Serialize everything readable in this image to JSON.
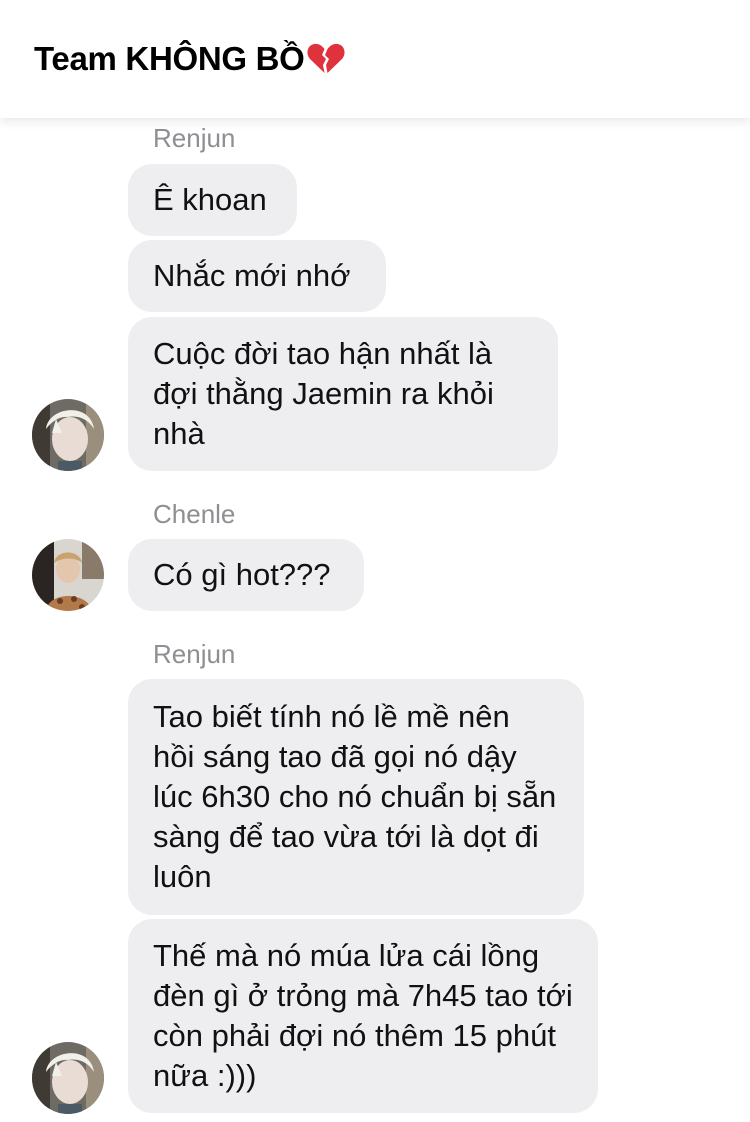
{
  "header": {
    "title": "Team KHÔNG BỒ",
    "title_icon": "broken-heart-icon"
  },
  "messages": [
    {
      "sender": "Renjun"
    },
    {
      "text": "Ê khoan"
    },
    {
      "text": "Nhắc mới nhớ"
    },
    {
      "text": "Cuộc đời tao hận nhất là đợi thằng Jaemin ra khỏi nhà"
    },
    {
      "sender": "Chenle"
    },
    {
      "text": "Có gì hot???"
    },
    {
      "sender": "Renjun"
    },
    {
      "text": "Tao biết tính nó lề mề nên hồi sáng tao đã gọi nó dậy lúc 6h30 cho nó chuẩn bị sẵn sàng để tao vừa tới là dọt đi luôn"
    },
    {
      "text": "Thế mà nó múa lửa cái lồng đèn gì ở trỏng mà 7h45 tao tới còn phải đợi nó thêm 15 phút nữa :)))"
    }
  ],
  "colors": {
    "bubble": "#eeeef0",
    "sender": "#8e8e93",
    "heart": "#e0323c"
  }
}
